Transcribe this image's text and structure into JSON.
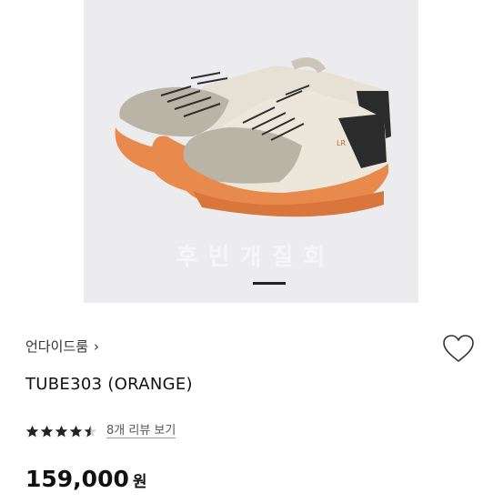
{
  "product_image": {
    "watermark_text": "후 빈 개 질 회",
    "image_count_indicator": "1/1"
  },
  "brand": {
    "name": "언다이드룸",
    "chevron_icon": "chevron-right-icon"
  },
  "wishlist": {
    "icon": "heart-outline-icon"
  },
  "product": {
    "title": "TUBE303 (ORANGE)"
  },
  "rating": {
    "score": 4.5,
    "max": 5,
    "review_link_label": "8개 리뷰 보기"
  },
  "price": {
    "amount": "159,000",
    "unit": "원"
  },
  "colors": {
    "sole": "#e88a4c",
    "suede": "#b9b4a5",
    "canvas": "#e6e1d4",
    "heel_patch": "#2b2b2b"
  }
}
